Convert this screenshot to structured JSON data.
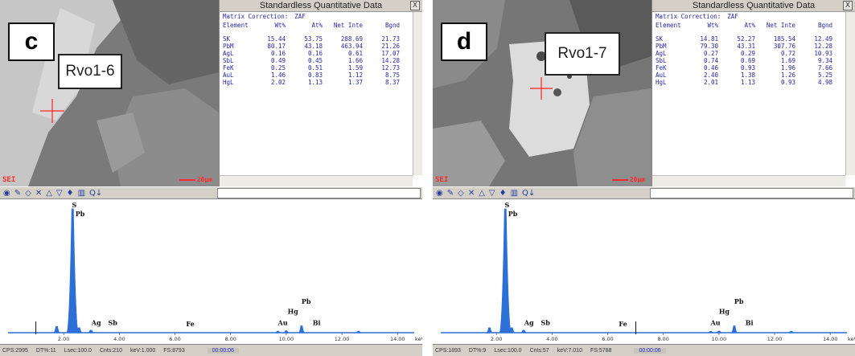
{
  "panels": [
    {
      "id": "c",
      "tag": "c",
      "callout": "Rvo1-6",
      "sem_label": "SEI",
      "scale_label": "20µm",
      "quant": {
        "title": "Standardless Quantitative Data",
        "close_label": "X",
        "matrix_label": "Matrix Correction:",
        "matrix_value": "ZAF",
        "headers": [
          "Element",
          "Wt%",
          "At%",
          "Net Inte",
          "Bgnd"
        ],
        "rows": [
          [
            "SK",
            "15.44",
            "53.75",
            "288.69",
            "21.73"
          ],
          [
            "PbM",
            "80.17",
            "43.18",
            "463.94",
            "21.26"
          ],
          [
            "AgL",
            "0.16",
            "0.16",
            "0.61",
            "17.07"
          ],
          [
            "SbL",
            "0.49",
            "0.45",
            "1.66",
            "14.28"
          ],
          [
            "FeK",
            "0.25",
            "0.51",
            "1.59",
            "12.73"
          ],
          [
            "AuL",
            "1.46",
            "0.83",
            "1.12",
            "8.75"
          ],
          [
            "HgL",
            "2.02",
            "1.13",
            "1.37",
            "8.37"
          ]
        ]
      },
      "status": {
        "cps": "CPS:2995",
        "dt": "DT%:11",
        "lsec": "Lsec:100.0",
        "cnts": "Cnts:210",
        "kev": "keV:1.000",
        "fs": "FS:8793",
        "elapsed": "00:00:06"
      }
    },
    {
      "id": "d",
      "tag": "d",
      "callout": "Rvo1-7",
      "sem_label": "SEI",
      "scale_label": "20µm",
      "quant": {
        "title": "Standardless Quantitative Data",
        "close_label": "X",
        "matrix_label": "Matrix Correction:",
        "matrix_value": "ZAF",
        "headers": [
          "Element",
          "Wt%",
          "At%",
          "Net Inte",
          "Bgnd"
        ],
        "rows": [
          [
            "SK",
            "14.81",
            "52.27",
            "185.54",
            "12.49"
          ],
          [
            "PbM",
            "79.30",
            "43.31",
            "307.76",
            "12.28"
          ],
          [
            "AgL",
            "0.27",
            "0.29",
            "0.72",
            "10.93"
          ],
          [
            "SbL",
            "0.74",
            "0.69",
            "1.69",
            "9.34"
          ],
          [
            "FeK",
            "0.46",
            "0.93",
            "1.96",
            "7.66"
          ],
          [
            "AuL",
            "2.40",
            "1.38",
            "1.26",
            "5.25"
          ],
          [
            "HgL",
            "2.01",
            "1.13",
            "0.93",
            "4.98"
          ]
        ]
      },
      "status": {
        "cps": "CPS:1893",
        "dt": "DT%:9",
        "lsec": "Lsec:100.0",
        "cnts": "Cnts:57",
        "kev": "keV:7.010",
        "fs": "FS:5788",
        "elapsed": "00:00:06"
      }
    }
  ],
  "toolbar_icons": [
    "spot-icon",
    "marker-icon",
    "expand-icon",
    "contract-icon",
    "up-icon",
    "down-icon",
    "peak-icon",
    "bars-icon",
    "zoom-icon"
  ],
  "colors": {
    "spectrum": "#2c6fd6",
    "crosshair": "#ff2020",
    "quant_text": "#2828a8"
  },
  "chart_data": [
    {
      "type": "area",
      "panel": "c",
      "xlim": [
        0,
        14.6
      ],
      "x_ticks": [
        "2.00",
        "4.00",
        "6.00",
        "8.00",
        "10.00",
        "12.00",
        "14.00"
      ],
      "x_unit": "keV",
      "peaks": [
        {
          "kev": 1.75,
          "height": 0.05
        },
        {
          "kev": 2.32,
          "height": 1.0
        },
        {
          "kev": 2.55,
          "height": 0.04
        },
        {
          "kev": 2.98,
          "height": 0.02
        },
        {
          "kev": 9.7,
          "height": 0.012
        },
        {
          "kev": 10.0,
          "height": 0.015
        },
        {
          "kev": 10.55,
          "height": 0.055
        },
        {
          "kev": 12.6,
          "height": 0.012
        }
      ],
      "labels": [
        {
          "text": "S",
          "kev": 2.3,
          "height": 1.0
        },
        {
          "text": "Pb",
          "kev": 2.42,
          "height": 0.93
        },
        {
          "text": "Ag",
          "kev": 3.0,
          "height": 0.05
        },
        {
          "text": "Sb",
          "kev": 3.6,
          "height": 0.05
        },
        {
          "text": "Fe",
          "kev": 6.4,
          "height": 0.04
        },
        {
          "text": "Au",
          "kev": 9.7,
          "height": 0.05
        },
        {
          "text": "Hg",
          "kev": 10.05,
          "height": 0.14
        },
        {
          "text": "Pb",
          "kev": 10.55,
          "height": 0.22
        },
        {
          "text": "Bi",
          "kev": 10.95,
          "height": 0.05
        }
      ],
      "cursor_kev": 1.0
    },
    {
      "type": "area",
      "panel": "d",
      "xlim": [
        0,
        14.6
      ],
      "x_ticks": [
        "2.00",
        "4.00",
        "6.00",
        "8.00",
        "10.00",
        "12.00",
        "14.00"
      ],
      "x_unit": "keV",
      "peaks": [
        {
          "kev": 1.75,
          "height": 0.04
        },
        {
          "kev": 2.32,
          "height": 1.0
        },
        {
          "kev": 2.55,
          "height": 0.04
        },
        {
          "kev": 2.98,
          "height": 0.02
        },
        {
          "kev": 9.7,
          "height": 0.01
        },
        {
          "kev": 10.0,
          "height": 0.013
        },
        {
          "kev": 10.55,
          "height": 0.055
        },
        {
          "kev": 12.6,
          "height": 0.012
        }
      ],
      "labels": [
        {
          "text": "S",
          "kev": 2.3,
          "height": 1.0
        },
        {
          "text": "Pb",
          "kev": 2.42,
          "height": 0.93
        },
        {
          "text": "Ag",
          "kev": 3.0,
          "height": 0.05
        },
        {
          "text": "Sb",
          "kev": 3.6,
          "height": 0.05
        },
        {
          "text": "Fe",
          "kev": 6.4,
          "height": 0.04
        },
        {
          "text": "Au",
          "kev": 9.7,
          "height": 0.05
        },
        {
          "text": "Hg",
          "kev": 10.0,
          "height": 0.14
        },
        {
          "text": "Pb",
          "kev": 10.55,
          "height": 0.22
        },
        {
          "text": "Bi",
          "kev": 10.95,
          "height": 0.05
        }
      ],
      "cursor_kev": 7.01
    }
  ]
}
